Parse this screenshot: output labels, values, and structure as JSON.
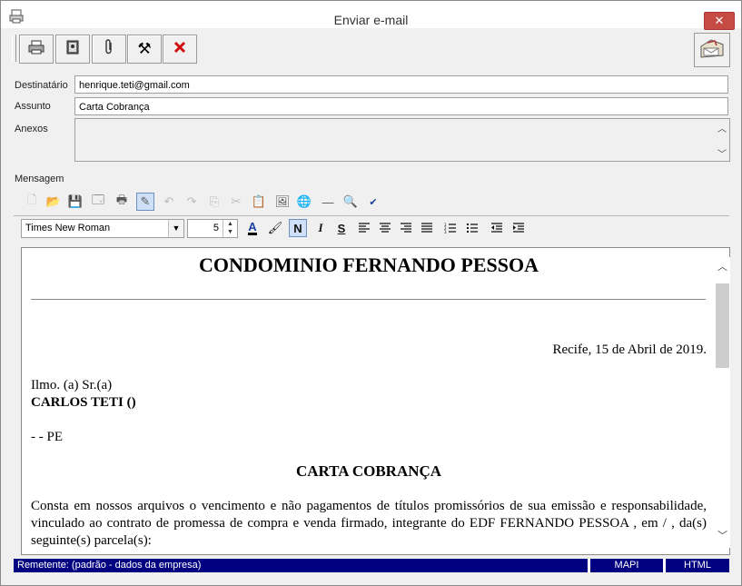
{
  "window": {
    "title": "Enviar e-mail",
    "close_glyph": "✕"
  },
  "toolbar": {
    "buttons": [
      {
        "name": "print-preview-icon",
        "glyph": "🖨"
      },
      {
        "name": "address-book-icon",
        "glyph": "📇"
      },
      {
        "name": "paperclip-icon",
        "glyph": "📎"
      },
      {
        "name": "tools-icon",
        "glyph": "⚒"
      },
      {
        "name": "cancel-x-icon",
        "glyph": "✖"
      }
    ],
    "mailbox_icon": "mailbox-icon"
  },
  "form": {
    "destinatario_label": "Destinatário",
    "destinatario_value": "henrique.teti@gmail.com",
    "assunto_label": "Assunto",
    "assunto_value": "Carta Cobrança",
    "anexos_label": "Anexos",
    "mensagem_label": "Mensagem"
  },
  "editor_toolbar": [
    {
      "name": "new-doc-icon",
      "glyph": "🗋",
      "disabled": true
    },
    {
      "name": "open-icon",
      "glyph": "📂",
      "disabled": true
    },
    {
      "name": "save-icon",
      "glyph": "💾",
      "disabled": false
    },
    {
      "name": "properties-icon",
      "glyph": "🗔",
      "disabled": false
    },
    {
      "name": "print-icon",
      "glyph": "🖶",
      "disabled": false
    },
    {
      "name": "edit-mode-icon",
      "glyph": "✎",
      "disabled": false,
      "active": true
    },
    {
      "name": "undo-icon",
      "glyph": "↶",
      "disabled": true
    },
    {
      "name": "redo-icon",
      "glyph": "↷",
      "disabled": true
    },
    {
      "name": "copy-icon",
      "glyph": "⎘",
      "disabled": true
    },
    {
      "name": "cut-icon",
      "glyph": "✂",
      "disabled": true
    },
    {
      "name": "paste-icon",
      "glyph": "📋",
      "disabled": false
    },
    {
      "name": "insert-image-icon",
      "glyph": "🖼",
      "disabled": false
    },
    {
      "name": "insert-link-icon",
      "glyph": "🌐",
      "disabled": false
    },
    {
      "name": "horizontal-rule-icon",
      "glyph": "—",
      "disabled": false
    },
    {
      "name": "find-icon",
      "glyph": "🔍",
      "disabled": false
    },
    {
      "name": "spellcheck-icon",
      "glyph": "✔",
      "disabled": false
    }
  ],
  "format_bar": {
    "font_name": "Times New Roman",
    "font_size": "5",
    "bold_label": "N",
    "italic_label": "I",
    "strike_label": "S"
  },
  "document": {
    "heading": "CONDOMINIO FERNANDO PESSOA",
    "date_line": "Recife, 15 de Abril de 2019.",
    "salutation": "Ilmo. (a) Sr.(a)",
    "recipient": "CARLOS TETI ()",
    "address": "- - PE",
    "subtitle": "CARTA COBRANÇA",
    "body": "Consta em nossos arquivos o vencimento e não pagamentos de títulos promissórios de sua emissão e responsabilidade, vinculado ao contrato de promessa de compra e venda firmado, integrante do EDF FERNANDO PESSOA , em / , da(s) seguinte(s) parcela(s):"
  },
  "status": {
    "remetente": "Remetente:  (padrão - dados da empresa)",
    "mapi": "MAPI",
    "html": "HTML"
  }
}
